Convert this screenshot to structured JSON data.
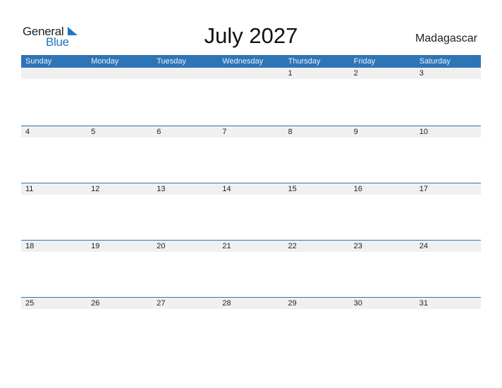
{
  "logo": {
    "general": "General",
    "blue": "Blue"
  },
  "title": "July 2027",
  "country": "Madagascar",
  "colors": {
    "header_bg": "#2e75b6",
    "date_row_bg": "#f0f0f0",
    "logo_blue": "#1e78c2"
  },
  "weekdays": [
    "Sunday",
    "Monday",
    "Tuesday",
    "Wednesday",
    "Thursday",
    "Friday",
    "Saturday"
  ],
  "weeks": [
    [
      "",
      "",
      "",
      "",
      "1",
      "2",
      "3"
    ],
    [
      "4",
      "5",
      "6",
      "7",
      "8",
      "9",
      "10"
    ],
    [
      "11",
      "12",
      "13",
      "14",
      "15",
      "16",
      "17"
    ],
    [
      "18",
      "19",
      "20",
      "21",
      "22",
      "23",
      "24"
    ],
    [
      "25",
      "26",
      "27",
      "28",
      "29",
      "30",
      "31"
    ]
  ]
}
